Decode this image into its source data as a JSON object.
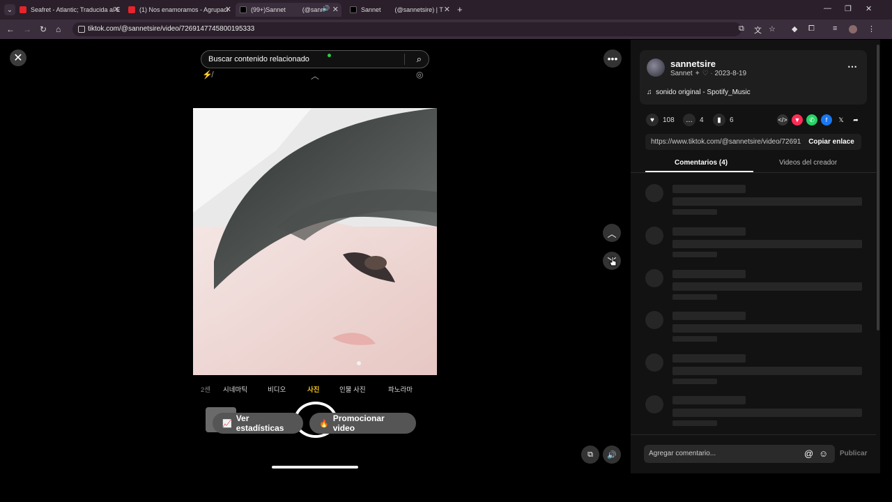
{
  "browser": {
    "tabs": [
      {
        "label": "Seafret - Atlantic; Traducida al E",
        "favicon": "youtube-icon"
      },
      {
        "label": "(1) Nos enamoramos - Agrupaci",
        "favicon": "youtube-icon"
      },
      {
        "label": "(99+)Sannet",
        "label_suffix": "(@sann",
        "favicon": "tiktok-icon",
        "active": true
      },
      {
        "label": "Sannet",
        "label_suffix": "(@sannetsire) | T",
        "favicon": "tiktok-icon"
      }
    ],
    "url": "tiktok.com/@sannetsire/video/7269147745800195333"
  },
  "player": {
    "search_placeholder": "Buscar contenido relacionado",
    "camera_modes": [
      "2센",
      "시네마틱",
      "비디오",
      "사진",
      "인물 사진",
      "파노라마"
    ],
    "active_mode_index": 3,
    "stats_button": "Ver estadísticas",
    "promote_button": "Promocionar video"
  },
  "panel": {
    "username": "sannetsire",
    "nickname": "Sannet",
    "date": "2023-8-19",
    "music": "sonido original - Spotify_Music",
    "likes": "108",
    "comments": "4",
    "saves": "6",
    "link": "https://www.tiktok.com/@sannetsire/video/72691...",
    "copy_link": "Copiar enlace",
    "tab_comments": "Comentarios (4)",
    "tab_creator": "Videos del creador",
    "comment_placeholder": "Agregar comentario...",
    "post_button": "Publicar"
  },
  "colors": {
    "chrome_bg": "#2a1f2b",
    "panel_bg": "#121212",
    "accent_mode": "#f0c419",
    "heart_share": "#fe2c55",
    "whatsapp": "#25d366",
    "facebook": "#1877f2"
  }
}
